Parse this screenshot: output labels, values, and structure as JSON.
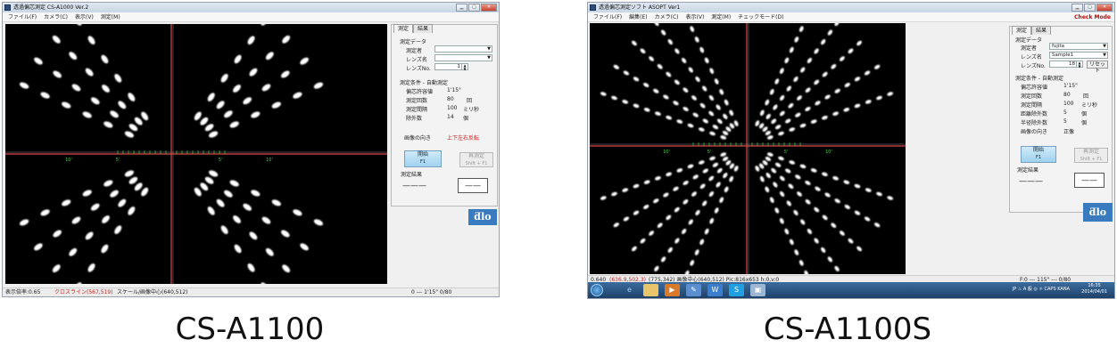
{
  "left": {
    "window_title": "透過偏芯測定 CS-A1000 Ver.2",
    "menu": [
      "ファイル(F)",
      "カメラ(C)",
      "表示(V)",
      "測定(M)"
    ],
    "tabs": [
      "測定",
      "結果"
    ],
    "group_data": "測定データ",
    "operator_label": "測定者",
    "lens_label": "レンズ名",
    "lens_no_label": "レンズNo.",
    "lens_no_value": "1",
    "group_cond": "測定条件 - 自動測定",
    "tolerance_label": "偏芯許容値",
    "tolerance_value": "1'15\"",
    "count_label": "測定回数",
    "count_value": "80",
    "count_unit": "回",
    "interval_label": "測定間隔",
    "interval_value": "100",
    "interval_unit": "ミリ秒",
    "excl_label": "除外数",
    "excl_value": "14",
    "excl_unit": "個",
    "orient_label": "画像の向き",
    "orient_value": "上下左右反転",
    "start_label": "開始",
    "start_key": "F1",
    "redo_label": "再測定",
    "redo_key": "Shift + F1",
    "result_label": "測定結果",
    "result_left": "———",
    "result_right": "——",
    "logo": "ƌlo",
    "status_a": "表示倍率:0.65",
    "status_b": "クロスライン(567,519)",
    "status_c": "スケール/画像中心(640,512)",
    "status_d": "0  ---  1'15\"  0/80",
    "scale_labels": [
      "10'",
      "5'",
      "5'",
      "10'"
    ]
  },
  "right": {
    "window_title": "透過偏芯測定ソフト ASOPT Ver1",
    "menu": [
      "ファイル(F)",
      "編集(E)",
      "カメラ(C)",
      "表示(V)",
      "測定(M)",
      "チェックモード(D)"
    ],
    "check_mode": "Check Mode",
    "tabs": [
      "測定",
      "結果"
    ],
    "group_data": "測定データ",
    "operator_label": "測定者",
    "operator_value": "fujita",
    "lens_label": "レンズ名",
    "lens_value": "Sample1",
    "lens_no_label": "レンズNo.",
    "lens_no_value": "18",
    "reset_label": "リセット",
    "group_cond": "測定条件 - 自動測定",
    "tolerance_label": "偏芯許容値",
    "tolerance_value": "1'15\"",
    "count_label": "測定回数",
    "count_value": "80",
    "count_unit": "回",
    "interval_label": "測定間隔",
    "interval_value": "100",
    "interval_unit": "ミリ秒",
    "dist_excl_label": "距離除外数",
    "dist_excl_value": "5",
    "dist_excl_unit": "個",
    "rad_excl_label": "半径除外数",
    "rad_excl_value": "5",
    "rad_excl_unit": "個",
    "orient_label": "画像の向き",
    "orient_value": "正像",
    "start_label": "開始",
    "start_key": "F1",
    "redo_label": "再測定",
    "redo_key": "Shift + F1",
    "result_label": "測定結果",
    "result_left": "———",
    "result_right": "——",
    "logo": "ƌlo",
    "status_a": "0.640",
    "status_b": "(636.9,502.3)",
    "status_c": "(775,342)  画像中心(640,512)  Pic:816x653  h:0,v:0",
    "status_d": "F:0  ---  115\"  ---  0/80",
    "clock_time": "16:35",
    "clock_date": "2014/04/01",
    "tray_text": "JP ♨ A 般 ◎ ☼ CAPS KANA",
    "scale_labels": [
      "10'",
      "5'",
      "5'",
      "10'"
    ]
  },
  "captions": {
    "left": "CS-A1100",
    "right": "CS-A1100S"
  },
  "colors": {
    "crosshair": "#e04848",
    "scale_tick": "#40d040",
    "spot": "#ffffff"
  }
}
